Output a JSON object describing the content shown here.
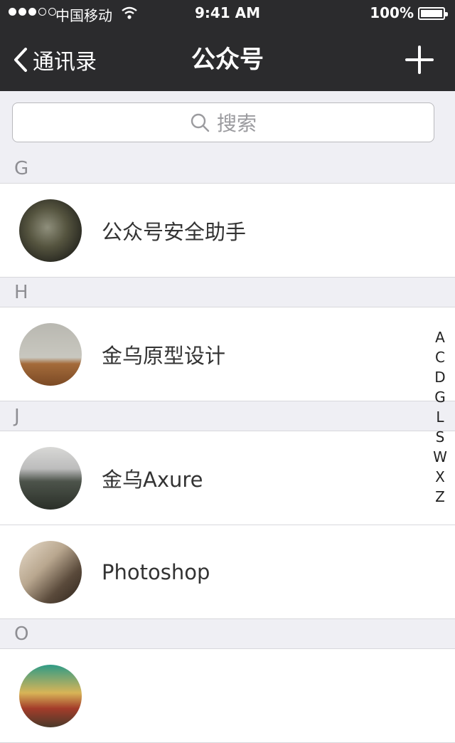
{
  "status": {
    "carrier": "中国移动",
    "time": "9:41 AM",
    "battery": "100%"
  },
  "nav": {
    "back_label": "通讯录",
    "title": "公众号",
    "add_icon": "plus-icon"
  },
  "search": {
    "placeholder": "搜索"
  },
  "sections": [
    {
      "letter": "G",
      "items": [
        {
          "name": "公众号安全助手"
        }
      ]
    },
    {
      "letter": "H",
      "items": [
        {
          "name": "金乌原型设计"
        }
      ]
    },
    {
      "letter": "J",
      "items": [
        {
          "name": "金乌Axure"
        },
        {
          "name": "Photoshop"
        }
      ]
    },
    {
      "letter": "O",
      "items": [
        {
          "name": ""
        }
      ]
    }
  ],
  "index_letters": [
    "A",
    "C",
    "D",
    "G",
    "L",
    "S",
    "W",
    "X",
    "Z"
  ],
  "colors": {
    "header_bg": "#2b2b2d",
    "section_bg": "#efeff4",
    "text": "#333333"
  }
}
